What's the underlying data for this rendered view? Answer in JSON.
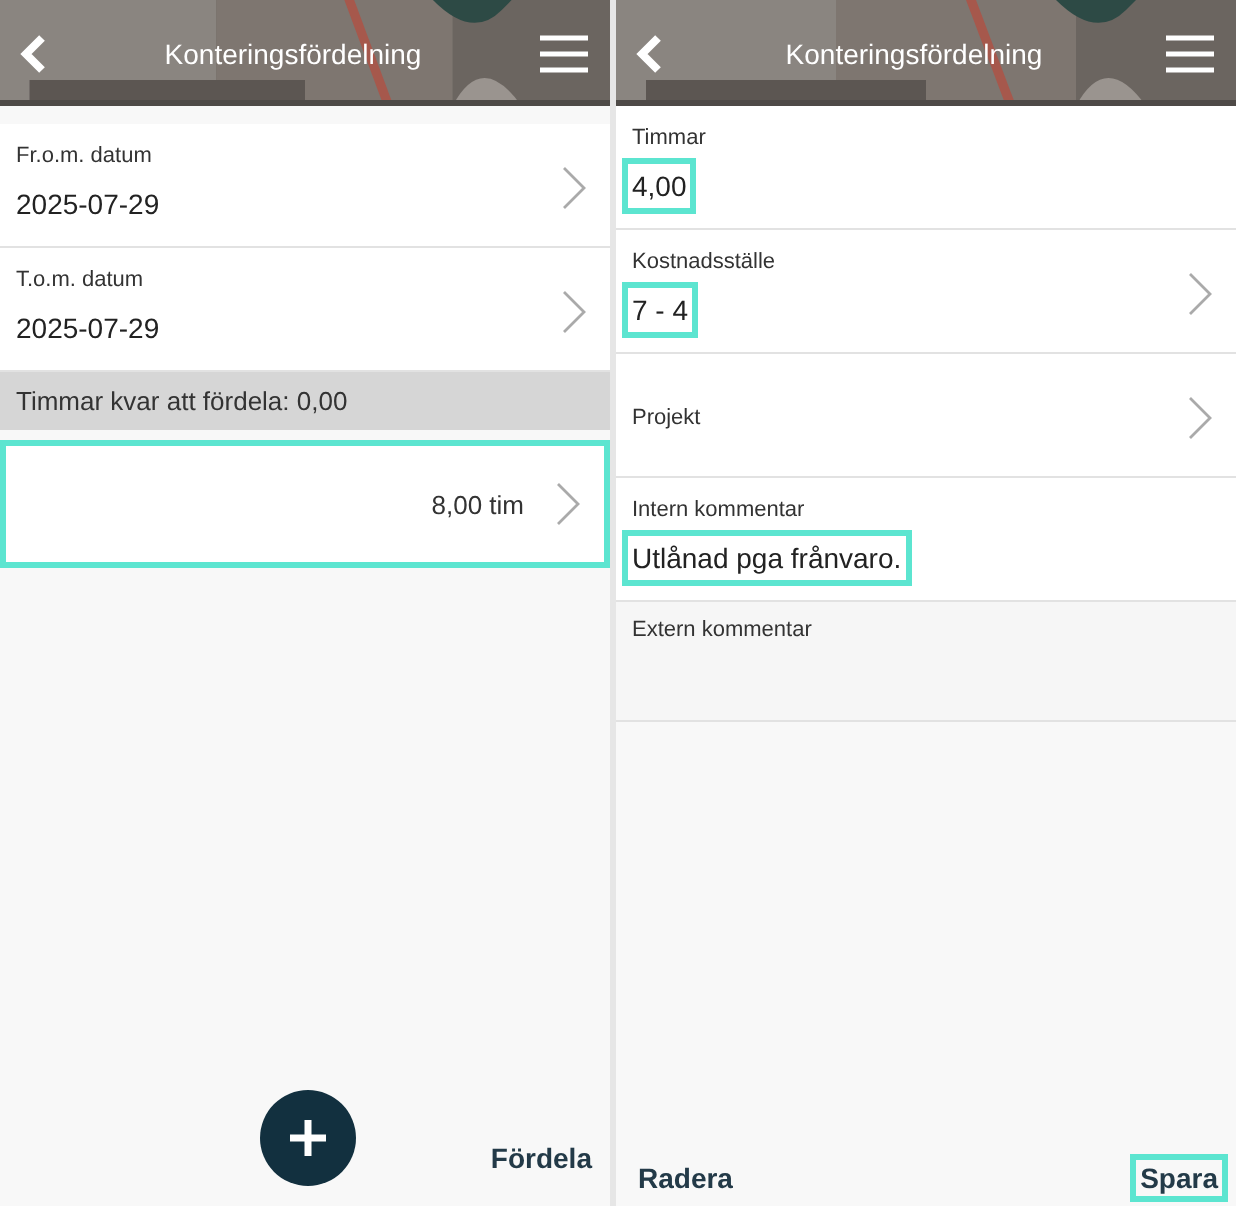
{
  "screens": [
    {
      "header": {
        "title": "Konteringsfördelning"
      },
      "items": [
        {
          "kind": "select",
          "label": "Fr.o.m. datum",
          "value": "2025-07-29",
          "highlighted": false
        },
        {
          "kind": "select",
          "label": "T.o.m. datum",
          "value": "2025-07-29",
          "highlighted": false
        },
        {
          "kind": "summary",
          "text": "Timmar kvar att fördela: 0,00"
        },
        {
          "kind": "allocation",
          "value": "8,00 tim",
          "highlighted": true
        }
      ],
      "actions": [
        {
          "kind": "fab",
          "highlighted": false
        },
        {
          "kind": "primary",
          "label": "Fördela",
          "highlighted": false
        }
      ]
    },
    {
      "header": {
        "title": "Konteringsfördelning"
      },
      "items": [
        {
          "kind": "text",
          "label": "Timmar",
          "value": "4,00",
          "highlighted": true
        },
        {
          "kind": "select",
          "label": "Kostnadsställe",
          "value": "7 - 4",
          "highlighted": true
        },
        {
          "kind": "select",
          "label": "Projekt",
          "highlighted": false
        },
        {
          "kind": "text",
          "label": "Intern kommentar",
          "value": "Utlånad pga frånvaro.",
          "highlighted": true
        },
        {
          "kind": "note",
          "label": "Extern kommentar",
          "highlighted": false
        }
      ],
      "actions": [
        {
          "kind": "secondary",
          "label": "Radera",
          "highlighted": false
        },
        {
          "kind": "primary",
          "label": "Spara",
          "highlighted": true
        }
      ]
    }
  ]
}
